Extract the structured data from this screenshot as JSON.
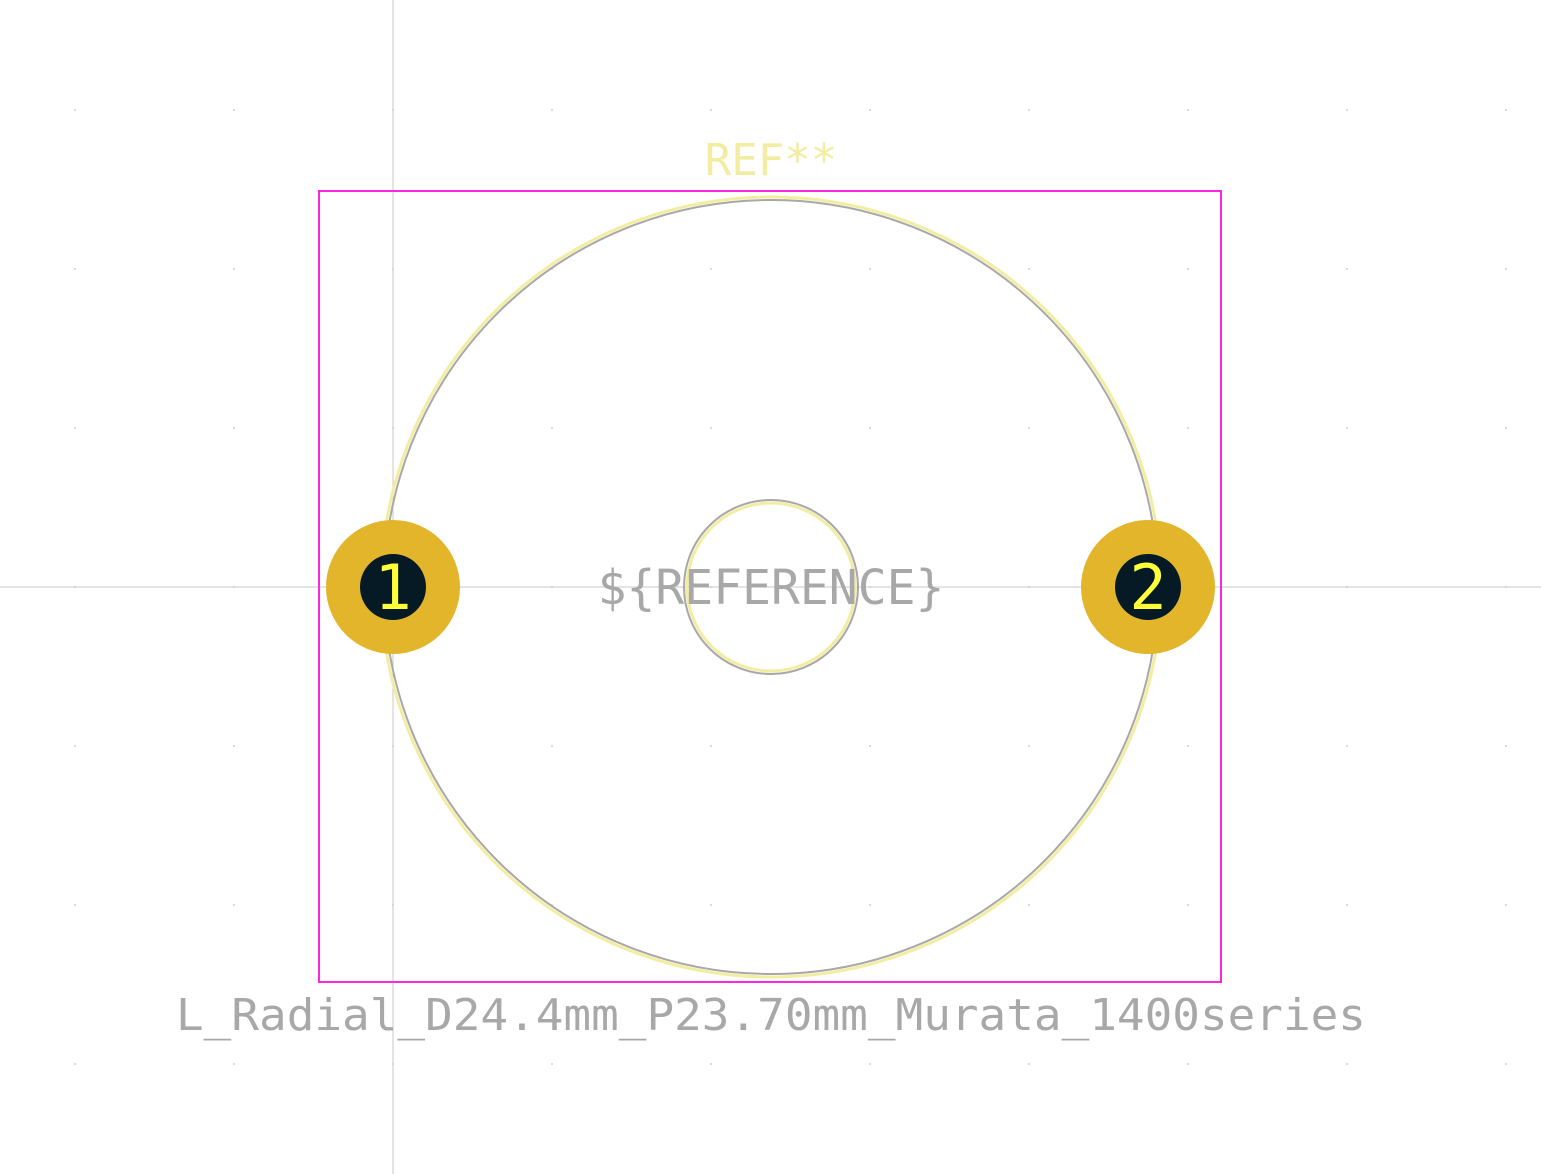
{
  "footprint": {
    "reference_text": "REF**",
    "reference_field": "${REFERENCE}",
    "value_text": "L_Radial_D24.4mm_P23.70mm_Murata_1400series"
  },
  "pads": [
    {
      "number": "1"
    },
    {
      "number": "2"
    }
  ],
  "colors": {
    "background": "#ffffff",
    "grid_dot": "#d0d0d0",
    "axis_line": "#c8c8c8",
    "courtyard": "#ff26e2",
    "silkscreen": "#f2eda1",
    "fabrication": "#a8a8a8",
    "pad_copper": "#e2b52b",
    "pad_hole": "#061a26",
    "pad_number": "#ffff3a"
  }
}
